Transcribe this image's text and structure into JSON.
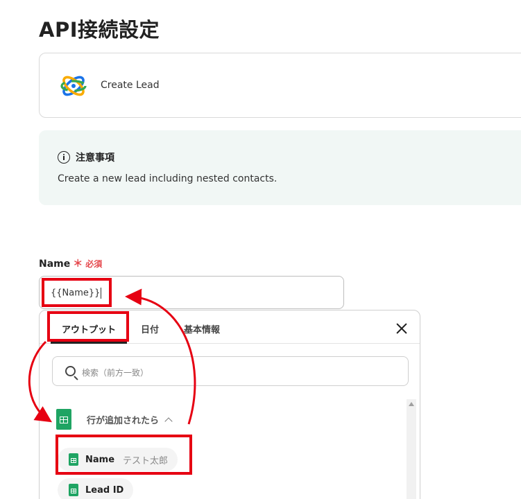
{
  "page": {
    "title": "API接続設定"
  },
  "app": {
    "name": "Create Lead",
    "logo": "atom-orbit-logo"
  },
  "notice": {
    "title": "注意事項",
    "text": "Create a new lead including nested contacts.",
    "background": "#f1f7f5"
  },
  "field": {
    "label": "Name",
    "required_mark": "＊",
    "required_text": "必須",
    "value": "{{Name}}"
  },
  "picker": {
    "tabs": [
      "アウトプット",
      "日付",
      "基本情報"
    ],
    "active_tab": "アウトプット",
    "search_placeholder": "検索（前方一致）",
    "group_label": "行が追加されたら",
    "items": [
      {
        "name": "Name",
        "value": "テスト太郎"
      },
      {
        "name": "Lead ID",
        "value": ""
      }
    ]
  },
  "colors": {
    "annotation": "#e60012",
    "sheets_green": "#1fa463",
    "required": "#e5484d"
  },
  "icons": [
    "atom-orbit-logo",
    "info-icon",
    "close-icon",
    "search-icon",
    "google-sheets-icon",
    "chevron-up-icon"
  ]
}
